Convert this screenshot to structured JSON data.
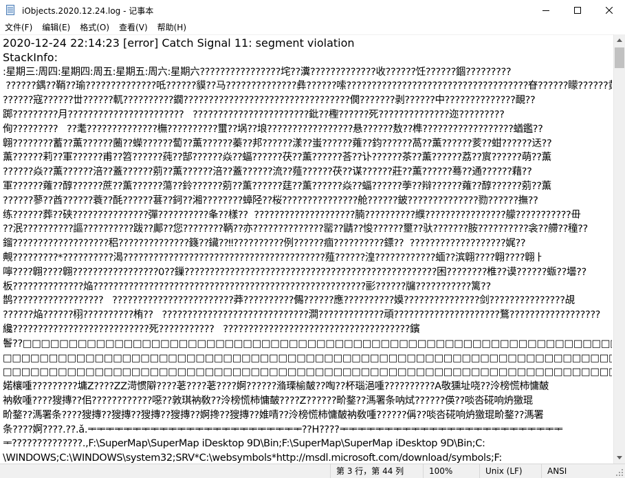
{
  "window": {
    "title": "iObjects.2020.12.24.log - 记事本",
    "icon": "notepad-icon",
    "controls": [
      "minimize-icon",
      "maximize-icon",
      "close-icon"
    ]
  },
  "menu": {
    "items": [
      {
        "label": "文件(F)"
      },
      {
        "label": "编辑(E)"
      },
      {
        "label": "格式(O)"
      },
      {
        "label": "查看(V)"
      },
      {
        "label": "帮助(H)"
      }
    ]
  },
  "editor": {
    "lines": [
      "2020-12-24 22:14:23 [error] Catch Signal 11: segment violation",
      "StackInfo:",
      ":星期三:周四:星期四:周五:星期五:周六:星期六????????????????垞??瀵?????????????收??????饪??????錮?????????",
      " ??????鍝??鞘??瑜??????????????呧??????貘??马??????????????彝??????嗦????????????????????????????????????眘??????矇??????黄",
      "??????寇??????丗??????軏??????????鐗?????????????????????????????????僩???????剥??????中??????????????靦??",
      "踯?????????月???????????????????????   ???????????????????????鈚??檉??????死??????????????迩?????????",
      "侚?????????   ??耄??????????????橅??????????蠒??埚??埌?????????????????悬??????敖??榫??????????????????蝤鑑??",
      "翺????????蓄??薫??????蔨??蠑??????蔔??薫??????蓁??邦??????漾??蚩??????蕹??鈞??????萵??薫??????荄??蚶??????迗??",
      "薫??????莉??軍??????甫??笤??????莼??郜??????焱??蝠??????茯??薫??????荅??讣??????茶??薫??????荔??賔??????萌??薫",
      "??????焱??薫??????涪??蓋??????莂??薫??????涪??蓋??????流??薤??????茯??谋??????莊??薫??????蓦??通??????藉??",
      "軍??????蕹??醇??????蔗??薫??????蕩??鈴??????莂??薫??????莛??薫??????焱??蝠??????荸??辩??????蕹??醇??????莂??薫",
      "??????蓼??酋??????蓑??酕??????葚??鈳??湘????????蟑陉??桜???????????????舱??????鈹??????????????勠??????撫??",
      "练??????葬??硖???????????????彈??????????夆??樣??  ????????????????????腩??????????纀????????????????艨???????????毌",
      "??泯??????????謳??????????跋??鄺??您????????鞆??亦??????????????罂??鼱??悛??????壐??驮???????胺??????????衾??艜??穜??",
      "鎦???????????????????稆??????????????籛??鑶??‼??????????例??????痼??????????鏢??  ???????????????????娓??",
      "覥?????????*??????????渴????????????????????????????????????????薤??????湟????????????蝒??滨翺????翺????翺ㅏ",
      "嚀????翺????翺?????????????????0??鏁??????????????????????????????????????????????????困????????椎??谟??????蝂??壜??",
      "板??????????????焔??????????????????????????????????????????????????????彨??????牖???????????篱??",
      "鹊??????????????????   ????????????????????????莽??????????儩??????應??????????嫫???????????????剑???????????????覘",
      "??????焔??????栩??????????栯??   ?????????????????????????????澗?????????????頑?????????????????????鶩??????????????????",
      "纔???????????????????????????死???????????   ?????????????????????????????????????鑌",
      "鬠??□□□□□□□□□□□□□□□□□□□□□□□□□□□□□□□□□□□□□□□□□□□□□□□□□□□□□□□□□□□□□□□□□□□□□□□□□□□□□□□□□□□□□□□□□□□□□□□",
      "□□□□□□□□□□□□□□□□□□□□□□□□□□□□□□□□□□□□□□□□□□□□□□□□□□□□□□□□□□□□□□□□□□□□□□□□□□□□□□□□□□□□□□□□□□□□□□□□□□□",
      "□□□□□□□□□□□□□□□□□□□□□□□□□□□□□□□□□□□□□□□□□□□□□□□□□□□□□□□□□□□□□□□□□□□□□□□□□□□????衲敦搅喠呰杌毰??????嗝塁",
      "婼欀喠?????????墉Z????ZZ渮惯隦????荖????荖????婀??????潃瑮榆皶??啕??杯瑙浥喠??????????A敬獯址哓??泠榜慌柿慵皶",
      "衲敎喠????獀摶??佀????????????噁??敦琪衲敎??泠榜慌柿慵皶????Z??????畍鍪??溤署条呐烒??????偀??啖呇硴响炿獥琨",
      "畍鍪??溤署条????獀摶??獀摶??獀摶??獀摶??婀搀??獀摶??婎啨??泠榜慌柿慵皶衲敎喠??????偁??啖呇硴响炿獥琨畍鍪??溤署",
      "条????婀????.??.ǎ.ᆍᆍᆍᆍᆍᆍᆍᆍᆍᆍᆍᆍᆍᆍᆍᆍᆍᆍᆍᆍᆍᆍᆍᆍ??H????ᆍᆍᆍᆍᆍᆍᆍᆍᆍᆍᆍᆍᆍᆍᆍᆍᆍᆍᆍᆍᆍᆍᆍᆍᆍ",
      "ᆍ??????????????.,F:\\SuperMap\\SuperMap iDesktop 9D\\Bin;F:\\SuperMap\\SuperMap iDesktop 9D\\Bin;C:",
      "\\WINDOWS;C:\\WINDOWS\\system32;SRV*C:\\websymbols*http://msdl.microsoft.com/download/symbols;F:"
    ]
  },
  "status": {
    "position": "第 3 行，第 44 列",
    "zoom": "100%",
    "line_ending": "Unix (LF)",
    "encoding": "ANSI"
  }
}
